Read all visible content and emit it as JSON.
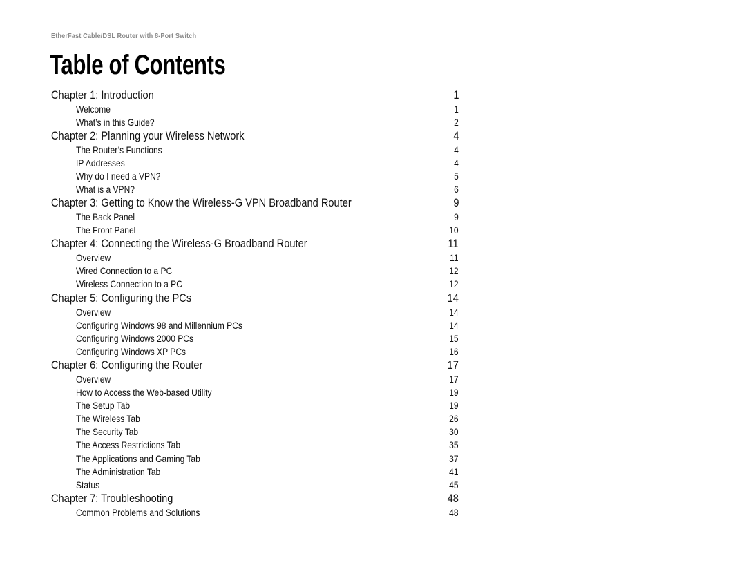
{
  "document": {
    "header": "EtherFast Cable/DSL Router with 8-Port Switch",
    "title": "Table of Contents",
    "chapters": [
      {
        "label": "Chapter 1: Introduction",
        "page": "1",
        "sections": [
          {
            "label": "Welcome",
            "page": "1"
          },
          {
            "label": "What’s in this Guide?",
            "page": "2"
          }
        ]
      },
      {
        "label": "Chapter 2: Planning your Wireless Network",
        "page": "4",
        "sections": [
          {
            "label": "The Router’s Functions",
            "page": "4"
          },
          {
            "label": "IP Addresses",
            "page": "4"
          },
          {
            "label": "Why do I need a VPN?",
            "page": "5"
          },
          {
            "label": "What is a VPN?",
            "page": "6"
          }
        ]
      },
      {
        "label": "Chapter 3: Getting to Know the Wireless-G VPN Broadband Router",
        "page": "9",
        "sections": [
          {
            "label": "The Back Panel",
            "page": "9"
          },
          {
            "label": "The Front Panel",
            "page": "10"
          }
        ]
      },
      {
        "label": "Chapter 4: Connecting the Wireless-G Broadband Router",
        "page": "11",
        "sections": [
          {
            "label": "Overview",
            "page": "11"
          },
          {
            "label": "Wired Connection to a PC",
            "page": "12"
          },
          {
            "label": "Wireless Connection to a PC",
            "page": "12"
          }
        ]
      },
      {
        "label": "Chapter 5: Configuring the PCs",
        "page": "14",
        "sections": [
          {
            "label": "Overview",
            "page": "14"
          },
          {
            "label": "Configuring Windows 98 and Millennium PCs",
            "page": "14"
          },
          {
            "label": "Configuring Windows 2000 PCs",
            "page": "15"
          },
          {
            "label": "Configuring Windows XP PCs",
            "page": "16"
          }
        ]
      },
      {
        "label": "Chapter 6: Configuring the Router",
        "page": "17",
        "sections": [
          {
            "label": "Overview",
            "page": "17"
          },
          {
            "label": "How to Access the Web-based Utility",
            "page": "19"
          },
          {
            "label": "The Setup Tab",
            "page": "19"
          },
          {
            "label": "The Wireless Tab",
            "page": "26"
          },
          {
            "label": "The Security Tab",
            "page": "30"
          },
          {
            "label": "The Access Restrictions Tab",
            "page": "35"
          },
          {
            "label": "The Applications and Gaming Tab",
            "page": "37"
          },
          {
            "label": "The Administration Tab",
            "page": "41"
          },
          {
            "label": "Status",
            "page": "45"
          }
        ]
      },
      {
        "label": "Chapter 7: Troubleshooting",
        "page": "48",
        "sections": [
          {
            "label": "Common Problems and Solutions",
            "page": "48"
          }
        ]
      }
    ]
  }
}
